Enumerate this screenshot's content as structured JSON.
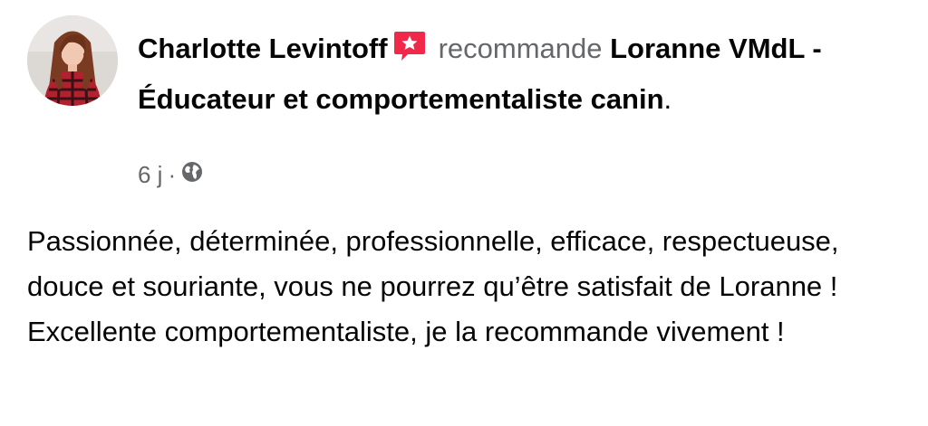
{
  "post": {
    "author": "Charlotte Levintoff",
    "recommendation_word": "recommande",
    "page_name": "Loranne VMdL - Éducateur et comportementaliste canin",
    "trailing_period": ".",
    "time_ago": "6 j",
    "separator": "·",
    "review_text": "Passionnée, déterminée, professionnelle, efficace, respectueuse, douce et souriante, vous ne pourrez qu’être satisfait de Loranne ! Excellente comportementaliste, je la recommande vivement !"
  },
  "icons": {
    "badge": "recommendation-star-icon",
    "audience": "globe-icon"
  },
  "colors": {
    "badge": "#f02849",
    "secondary_text": "#65676b",
    "primary_text": "#050505"
  }
}
